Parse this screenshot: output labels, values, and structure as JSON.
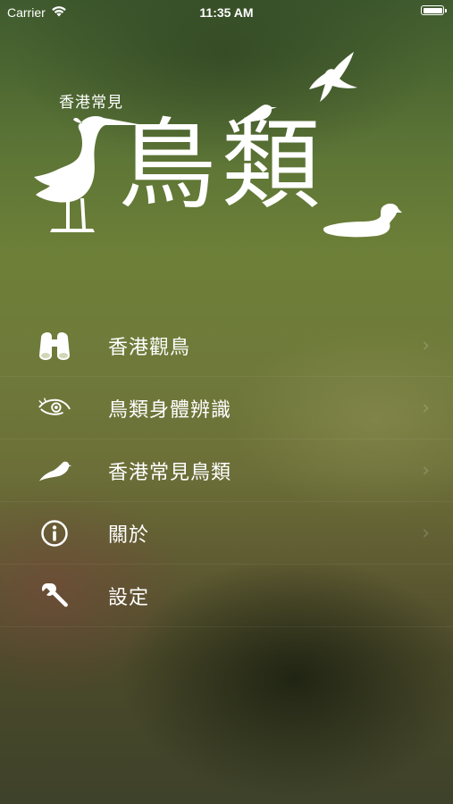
{
  "status_bar": {
    "carrier": "Carrier",
    "time": "11:35 AM"
  },
  "logo": {
    "subtitle": "香港常見",
    "title": "鳥類"
  },
  "menu": {
    "items": [
      {
        "label": "香港觀鳥",
        "icon": "binoculars-icon",
        "has_chevron": true
      },
      {
        "label": "鳥類身體辨識",
        "icon": "bird-eye-icon",
        "has_chevron": true
      },
      {
        "label": "香港常見鳥類",
        "icon": "dove-icon",
        "has_chevron": true
      },
      {
        "label": "關於",
        "icon": "info-icon",
        "has_chevron": true
      },
      {
        "label": "設定",
        "icon": "wrench-icon",
        "has_chevron": false
      }
    ]
  }
}
